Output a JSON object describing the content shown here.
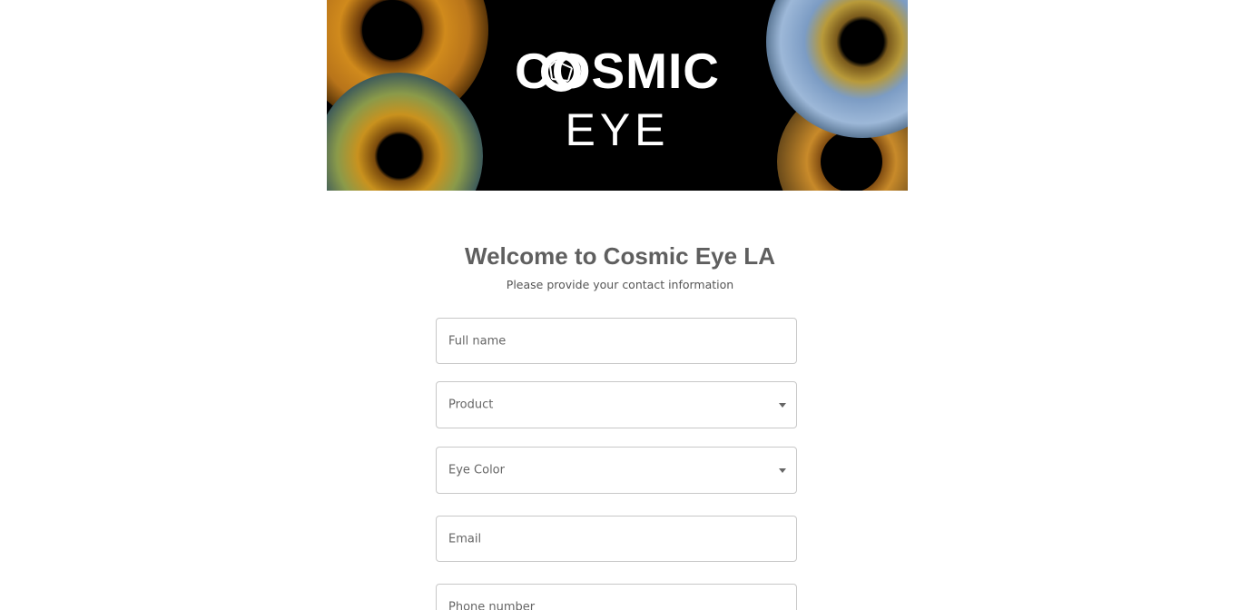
{
  "banner": {
    "logo_word1": "COSMIC",
    "logo_word2": "EYE"
  },
  "form": {
    "title": "Welcome to Cosmic Eye LA",
    "subtitle": "Please provide your contact information",
    "fields": {
      "full_name": "Full name",
      "product": "Product",
      "eye_color": "Eye Color",
      "email": "Email",
      "phone": "Phone number"
    }
  },
  "colors": {
    "heading": "#5f5f5f",
    "border": "#c8c8c8",
    "banner_bg": "#000000"
  }
}
